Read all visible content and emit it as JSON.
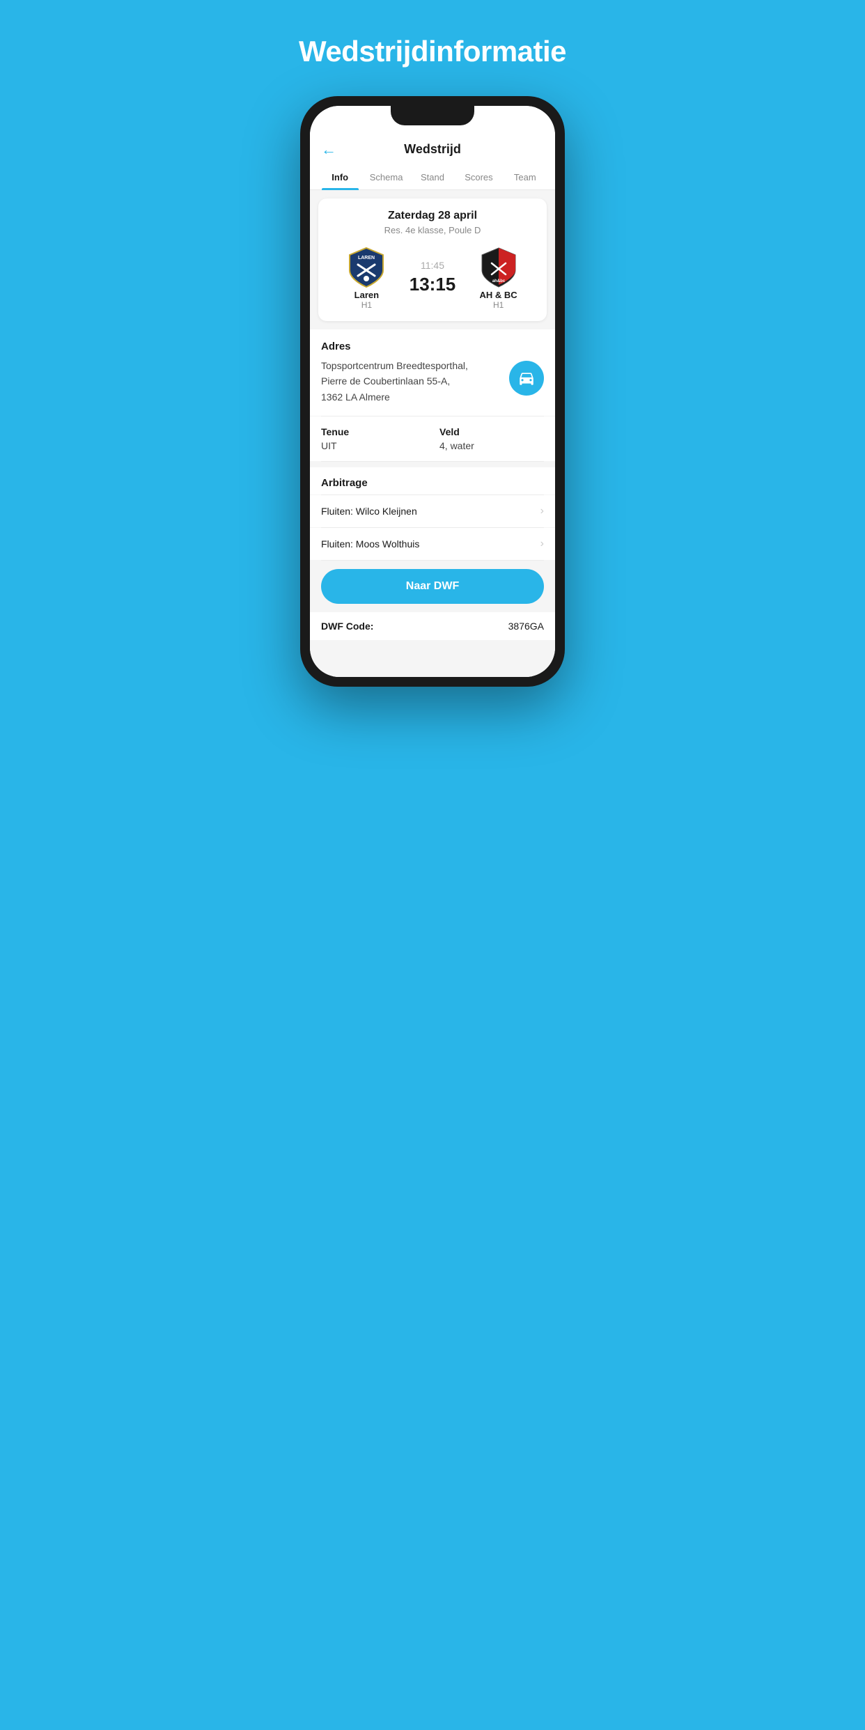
{
  "page": {
    "title": "Wedstrijdinformatie",
    "header": {
      "back_label": "←",
      "title": "Wedstrijd"
    },
    "tabs": [
      {
        "id": "info",
        "label": "Info",
        "active": true
      },
      {
        "id": "schema",
        "label": "Schema",
        "active": false
      },
      {
        "id": "stand",
        "label": "Stand",
        "active": false
      },
      {
        "id": "scores",
        "label": "Scores",
        "active": false
      },
      {
        "id": "team",
        "label": "Team",
        "active": false
      }
    ],
    "match": {
      "date": "Zaterdag 28 april",
      "league": "Res. 4e klasse, Poule D",
      "home_team": "Laren",
      "home_sub": "H1",
      "away_team": "AH & BC",
      "away_sub": "H1",
      "time": "11:45",
      "score": "13:15"
    },
    "address": {
      "label": "Adres",
      "text": "Topsportcentrum Breedtesporthal,\nPierre de Coubertinlaan 55-A,\n1362 LA Almere"
    },
    "tenue": {
      "label": "Tenue",
      "value": "UIT"
    },
    "veld": {
      "label": "Veld",
      "value": "4, water"
    },
    "arbitrage": {
      "label": "Arbitrage",
      "items": [
        {
          "text": "Fluiten: Wilco Kleijnen"
        },
        {
          "text": "Fluiten: Moos Wolthuis"
        }
      ]
    },
    "dwf_button": "Naar DWF",
    "dwf_code_label": "DWF Code:",
    "dwf_code_value": "3876GA",
    "colors": {
      "accent": "#29b5e8",
      "text_primary": "#1a1a1a",
      "text_secondary": "#888888"
    }
  }
}
